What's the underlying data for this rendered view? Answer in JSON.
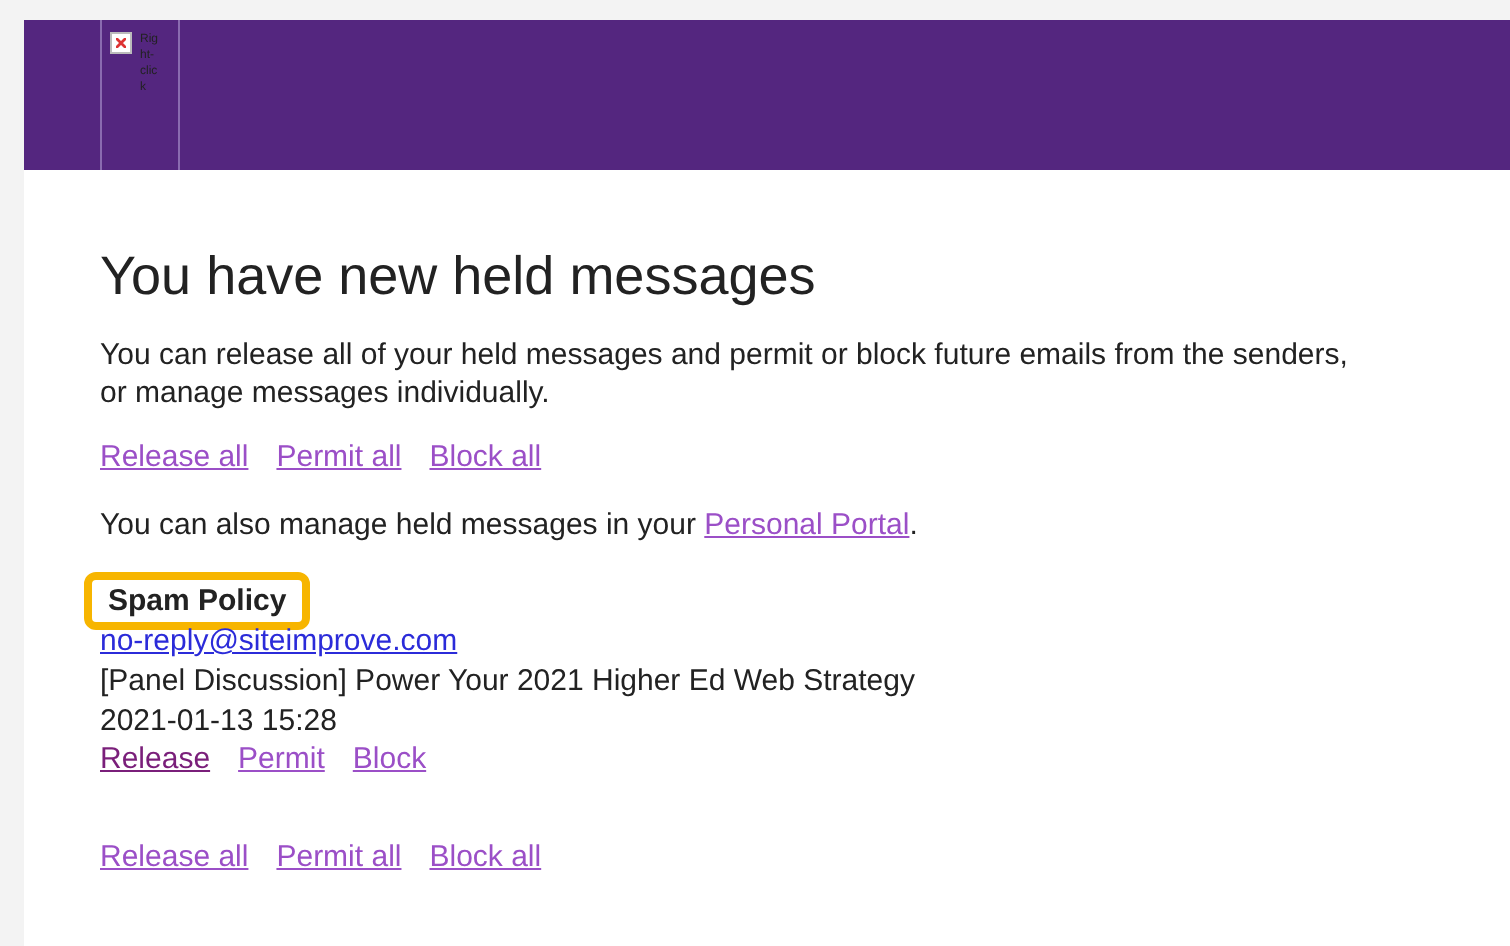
{
  "header": {
    "image_alt": "Right-click"
  },
  "title": "You have new held messages",
  "intro": "You can release all of your held messages and permit or block future emails from the senders, or manage messages individually.",
  "top_actions": [
    {
      "label": "Release all",
      "visited": false
    },
    {
      "label": "Permit all",
      "visited": false
    },
    {
      "label": "Block all",
      "visited": false
    }
  ],
  "portal_text": {
    "before": "You can also manage held messages in your ",
    "link": "Personal Portal",
    "after": "."
  },
  "message": {
    "policy": "Spam Policy",
    "highlighted": true,
    "sender": "no-reply@siteimprove.com",
    "subject": "[Panel Discussion] Power Your 2021 Higher Ed Web Strategy",
    "date": "2021-01-13 15:28",
    "actions": [
      {
        "label": "Release",
        "visited": true
      },
      {
        "label": "Permit",
        "visited": false
      },
      {
        "label": "Block",
        "visited": false
      }
    ]
  },
  "bottom_actions": [
    {
      "label": "Release all",
      "visited": false
    },
    {
      "label": "Permit all",
      "visited": false
    },
    {
      "label": "Block all",
      "visited": false
    }
  ]
}
